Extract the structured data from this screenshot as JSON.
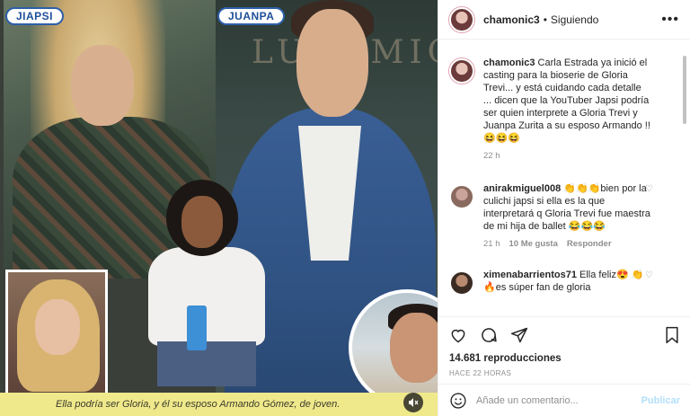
{
  "media": {
    "label_left": "JIAPSI",
    "label_right": "JUANPA",
    "brand_text": "LUIS MIGUEL",
    "caption": "Ella podría ser Gloria, y él su esposo Armando Gómez, de joven.",
    "mute_icon": "speaker-muted-icon"
  },
  "header": {
    "username": "chamonic3",
    "separator": "•",
    "follow_status": "Siguiendo",
    "more_icon": "•••"
  },
  "comments": [
    {
      "username": "chamonic3",
      "text": "Carla Estrada ya inició el casting para la bioserie de Gloria Trevi... y está cuidando cada detalle ... dicen que la YouTuber Japsi podría ser quien interprete a Gloria Trevi y Juanpa Zurita a su esposo Armando !! 😆😆😆",
      "time": "22 h"
    },
    {
      "username": "anirakmiguel008",
      "text": "👏👏👏bien por la culichi japsi si ella es la que interpretará q Gloria Trevi fue maestra de mi hija de ballet 😂😂😂",
      "time": "21 h",
      "likes": "10 Me gusta",
      "reply": "Responder"
    },
    {
      "username": "ximenabarrientos71",
      "text": "Ella feliz😍 👏🔥es súper fan de gloria"
    }
  ],
  "actions": {
    "views": "14.681 reproducciones",
    "timestamp": "HACE 22 HORAS"
  },
  "composer": {
    "placeholder": "Añade un comentario...",
    "publish": "Publicar"
  },
  "colors": {
    "label_blue": "#2d5fa8",
    "caption_bg": "#f0e98c",
    "publish_disabled": "#b2dffc",
    "muted_text": "#8e8e8e"
  }
}
